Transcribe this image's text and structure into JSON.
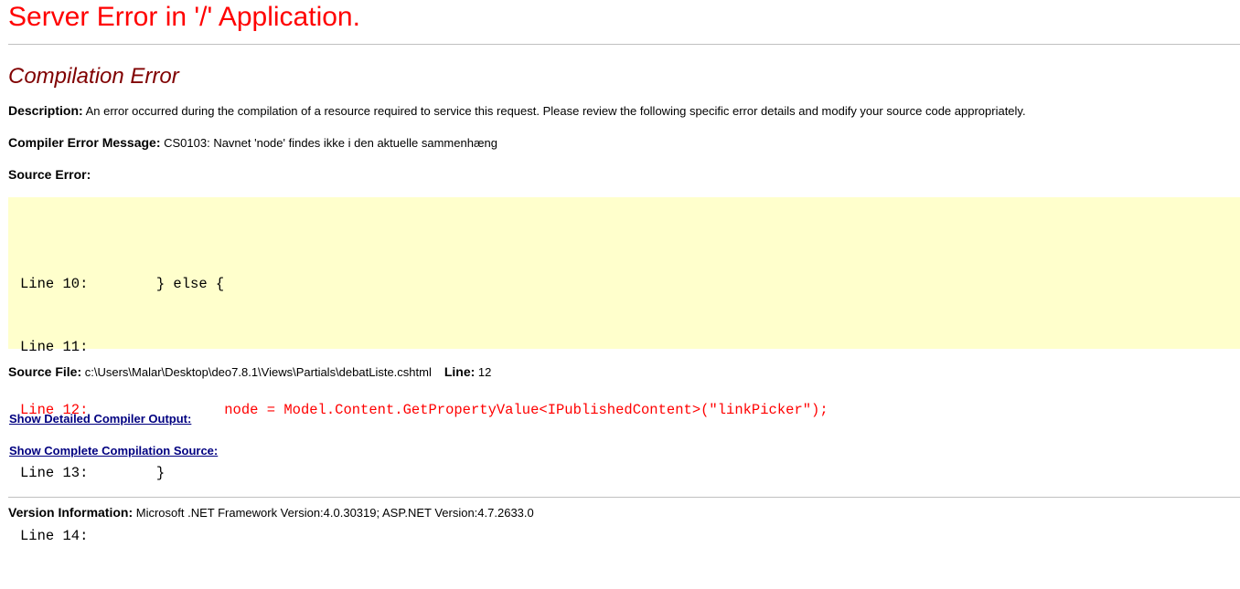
{
  "title": "Server Error in '/' Application.",
  "subtitle": "Compilation Error",
  "description": {
    "label": "Description:",
    "text": " An error occurred during the compilation of a resource required to service this request. Please review the following specific error details and modify your source code appropriately."
  },
  "compiler_message": {
    "label": "Compiler Error Message:",
    "text": " CS0103: Navnet 'node' findes ikke i den aktuelle sammenhæng"
  },
  "source_error_label": "Source Error:",
  "source_lines": [
    {
      "text": "Line 10:        } else {",
      "error": false
    },
    {
      "text": "Line 11:",
      "error": false
    },
    {
      "text": "Line 12:                node = Model.Content.GetPropertyValue<IPublishedContent>(\"linkPicker\");",
      "error": true
    },
    {
      "text": "Line 13:        }",
      "error": false
    },
    {
      "text": "Line 14:",
      "error": false
    }
  ],
  "source_file": {
    "label": "Source File:",
    "path": " c:\\Users\\Malar\\Desktop\\deo7.8.1\\Views\\Partials\\debatListe.cshtml",
    "line_label": "Line:",
    "line_value": " 12"
  },
  "links": {
    "detailed_output": "Show Detailed Compiler Output:",
    "complete_source": "Show Complete Compilation Source:"
  },
  "version": {
    "label": "Version Information:",
    "text": " Microsoft .NET Framework Version:4.0.30319; ASP.NET Version:4.7.2633.0"
  },
  "colors": {
    "title": "#ff0000",
    "subtitle": "#800000",
    "code_bg": "#ffffcc",
    "link": "#000080"
  }
}
